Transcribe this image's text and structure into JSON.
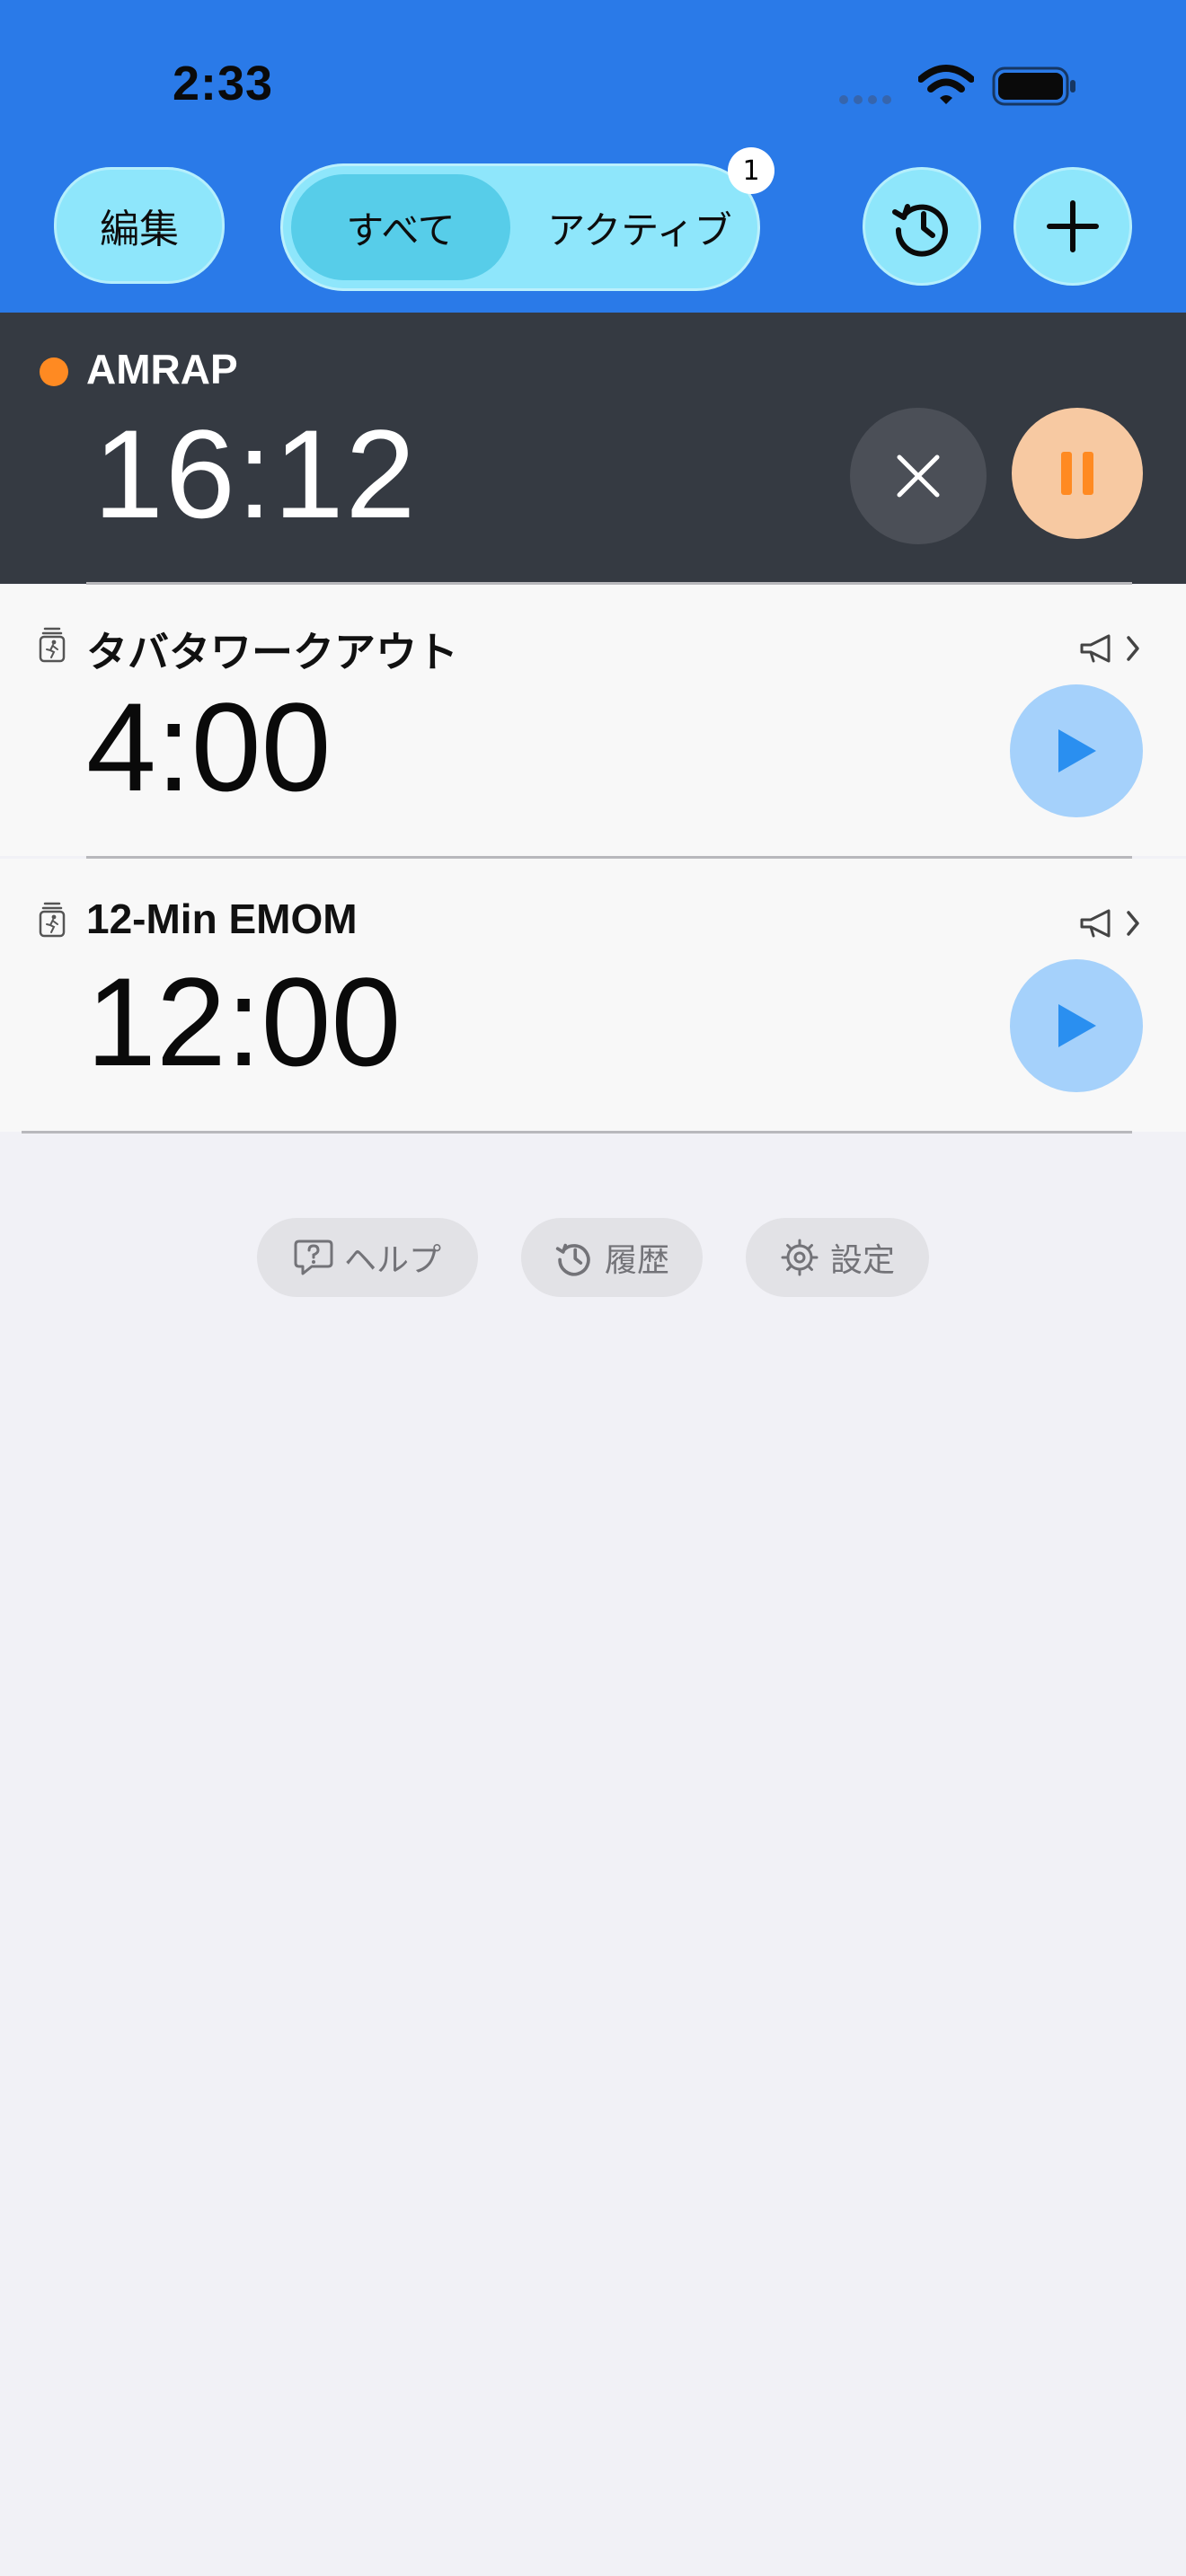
{
  "status_bar": {
    "time": "2:33"
  },
  "toolbar": {
    "edit_label": "編集",
    "segments": [
      {
        "label": "すべて",
        "selected": true
      },
      {
        "label": "アクティブ",
        "selected": false
      }
    ],
    "active_badge": "1",
    "history_icon": "clock-arrow-icon",
    "add_icon": "plus-icon"
  },
  "active_timer": {
    "name": "AMRAP",
    "time": "16:12",
    "status_color": "#ff8a22"
  },
  "timers": [
    {
      "name": "タバタワークアウト",
      "time": "4:00"
    },
    {
      "name": "12-Min EMOM",
      "time": "12:00"
    }
  ],
  "footer": {
    "help_label": "ヘルプ",
    "history_label": "履歴",
    "settings_label": "設定"
  },
  "colors": {
    "header": "#2a7ae8",
    "button": "#8ee6fb",
    "active_row": "#353a42",
    "pause": "#f7c9a2",
    "play": "#a5d1fb",
    "play_glyph": "#2a8ff0"
  }
}
